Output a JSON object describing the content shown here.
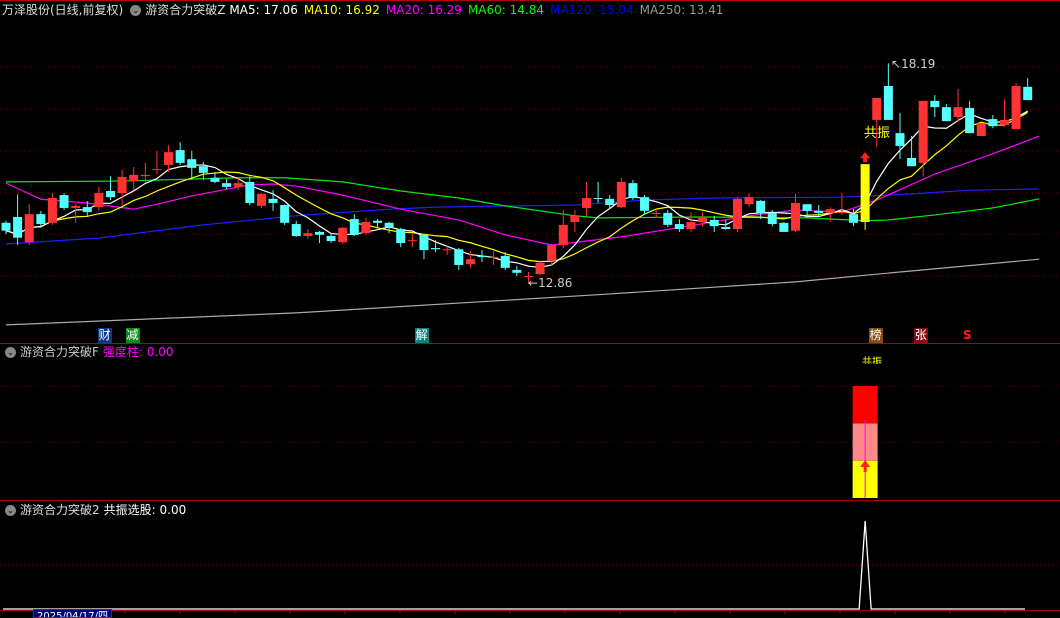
{
  "header": {
    "stock": "万泽股份(日线,前复权)",
    "indicator": "游资合力突破Z",
    "ma": [
      {
        "label": "MA5: 17.06",
        "color": "#ffffff"
      },
      {
        "label": "MA10: 16.92",
        "color": "#ffff00"
      },
      {
        "label": "MA20: 16.29",
        "color": "#ff00ff"
      },
      {
        "label": "MA60: 14.84",
        "color": "#00ff00"
      },
      {
        "label": "MA120: 15.04",
        "color": "#0000ff"
      },
      {
        "label": "MA250: 13.41",
        "color": "#999999"
      }
    ]
  },
  "annotations": {
    "high": "18.19",
    "low": "12.86",
    "resonance": "共振"
  },
  "event_tags": [
    {
      "text": "财",
      "bg": "#0a3a8a",
      "index": 8.5
    },
    {
      "text": "减",
      "bg": "#0a8a1a",
      "index": 10.9
    },
    {
      "text": "解",
      "bg": "#0a8080",
      "index": 35.8
    },
    {
      "text": "榜",
      "bg": "#8a4a10",
      "index": 74.9
    },
    {
      "text": "张",
      "bg": "#8a0a10",
      "index": 78.8
    }
  ],
  "sell_tag": {
    "text": "S",
    "index": 82.8
  },
  "panel2": {
    "title": "游资合力突破F",
    "value_label": "强度柱: 0.00",
    "resonance": "共振"
  },
  "panel3": {
    "title": "游资合力突破2",
    "value_label": "共振选股: 0.00"
  },
  "axis": {
    "date": "2025/04/17/四"
  },
  "colors": {
    "up": "#ff3333",
    "down": "#54ffff",
    "signal": "#ffff00",
    "grid": "#8b0000",
    "border": "#b00000"
  },
  "candles": [
    [
      14.33,
      14.14,
      14.38,
      14.06
    ],
    [
      14.47,
      13.97,
      15.02,
      13.79
    ],
    [
      13.86,
      14.54,
      14.78,
      13.79
    ],
    [
      14.54,
      14.3,
      14.62,
      14.21
    ],
    [
      14.33,
      14.93,
      15.05,
      14.28
    ],
    [
      15.0,
      14.69,
      15.05,
      14.64
    ],
    [
      14.69,
      14.74,
      14.78,
      14.33
    ],
    [
      14.71,
      14.59,
      14.86,
      14.47
    ],
    [
      14.71,
      15.05,
      15.2,
      14.62
    ],
    [
      15.1,
      14.95,
      15.46,
      14.88
    ],
    [
      15.05,
      15.44,
      15.61,
      14.76
    ],
    [
      15.34,
      15.49,
      15.68,
      15.12
    ],
    [
      15.46,
      15.49,
      15.78,
      15.29
    ],
    [
      15.61,
      15.63,
      16.07,
      15.51
    ],
    [
      15.73,
      16.04,
      16.21,
      15.56
    ],
    [
      16.09,
      15.78,
      16.28,
      15.73
    ],
    [
      15.87,
      15.66,
      16.07,
      15.37
    ],
    [
      15.7,
      15.54,
      15.8,
      15.37
    ],
    [
      15.42,
      15.32,
      15.56,
      15.29
    ],
    [
      15.29,
      15.2,
      15.39,
      15.15
    ],
    [
      15.2,
      15.29,
      15.42,
      15.12
    ],
    [
      15.32,
      14.81,
      15.46,
      14.76
    ],
    [
      14.74,
      15.03,
      15.05,
      14.69
    ],
    [
      14.91,
      14.81,
      15.12,
      14.62
    ],
    [
      14.76,
      14.33,
      14.78,
      14.28
    ],
    [
      14.3,
      14.01,
      14.38,
      13.99
    ],
    [
      14.01,
      14.08,
      14.18,
      13.94
    ],
    [
      14.11,
      14.04,
      14.13,
      13.84
    ],
    [
      14.01,
      13.89,
      14.08,
      13.84
    ],
    [
      13.86,
      14.21,
      14.23,
      13.82
    ],
    [
      14.42,
      14.04,
      14.54,
      14.01
    ],
    [
      14.08,
      14.35,
      14.45,
      14.04
    ],
    [
      14.38,
      14.33,
      14.42,
      14.21
    ],
    [
      14.33,
      14.23,
      14.35,
      14.08
    ],
    [
      14.18,
      13.84,
      14.21,
      13.74
    ],
    [
      13.89,
      13.91,
      14.06,
      13.74
    ],
    [
      14.04,
      13.67,
      14.04,
      13.45
    ],
    [
      13.72,
      13.69,
      13.91,
      13.62
    ],
    [
      13.67,
      13.69,
      13.79,
      13.55
    ],
    [
      13.69,
      13.31,
      13.72,
      13.19
    ],
    [
      13.33,
      13.45,
      13.65,
      13.24
    ],
    [
      13.53,
      13.5,
      13.67,
      13.38
    ],
    [
      13.48,
      13.5,
      13.65,
      13.31
    ],
    [
      13.53,
      13.24,
      13.62,
      13.19
    ],
    [
      13.19,
      13.12,
      13.29,
      13.04
    ],
    [
      13.02,
      13.04,
      13.14,
      12.86
    ],
    [
      13.09,
      13.36,
      13.41,
      13.07
    ],
    [
      13.41,
      13.79,
      13.82,
      13.31
    ],
    [
      13.79,
      14.28,
      14.64,
      13.72
    ],
    [
      14.35,
      14.5,
      14.64,
      14.11
    ],
    [
      14.69,
      14.93,
      15.32,
      14.5
    ],
    [
      14.93,
      14.91,
      15.32,
      14.81
    ],
    [
      14.91,
      14.76,
      15.0,
      14.69
    ],
    [
      14.71,
      15.32,
      15.42,
      14.69
    ],
    [
      15.29,
      14.93,
      15.37,
      14.88
    ],
    [
      14.95,
      14.62,
      15.0,
      14.52
    ],
    [
      14.57,
      14.57,
      14.66,
      14.45
    ],
    [
      14.57,
      14.28,
      14.64,
      14.23
    ],
    [
      14.3,
      14.18,
      14.42,
      14.11
    ],
    [
      14.18,
      14.35,
      14.59,
      14.11
    ],
    [
      14.35,
      14.45,
      14.59,
      14.23
    ],
    [
      14.4,
      14.25,
      14.5,
      14.11
    ],
    [
      14.23,
      14.18,
      14.4,
      14.16
    ],
    [
      14.18,
      14.91,
      14.95,
      14.11
    ],
    [
      14.78,
      14.95,
      15.05,
      14.71
    ],
    [
      14.86,
      14.57,
      14.88,
      14.42
    ],
    [
      14.57,
      14.3,
      14.64,
      14.25
    ],
    [
      14.33,
      14.11,
      14.35,
      14.11
    ],
    [
      14.14,
      14.81,
      15.03,
      14.11
    ],
    [
      14.78,
      14.62,
      14.78,
      14.45
    ],
    [
      14.62,
      14.57,
      14.76,
      14.49
    ],
    [
      14.57,
      14.66,
      14.71,
      14.35
    ],
    [
      14.59,
      14.59,
      15.05,
      14.52
    ],
    [
      14.54,
      14.33,
      14.66,
      14.25
    ],
    [
      14.35,
      15.75,
      15.75,
      14.16
    ],
    [
      16.82,
      17.35,
      17.35,
      16.16
    ],
    [
      17.64,
      16.82,
      18.19,
      16.82
    ],
    [
      16.5,
      16.19,
      16.99,
      15.87
    ],
    [
      15.9,
      15.7,
      16.43,
      15.7
    ],
    [
      15.78,
      17.28,
      17.28,
      15.46
    ],
    [
      17.28,
      17.13,
      17.42,
      16.89
    ],
    [
      17.13,
      16.79,
      17.2,
      16.79
    ],
    [
      16.89,
      17.13,
      17.57,
      16.77
    ],
    [
      17.11,
      16.5,
      17.28,
      16.5
    ],
    [
      16.43,
      16.74,
      16.74,
      16.43
    ],
    [
      16.84,
      16.67,
      16.94,
      16.62
    ],
    [
      16.7,
      16.82,
      17.32,
      16.65
    ],
    [
      16.6,
      17.64,
      17.71,
      16.6
    ],
    [
      17.62,
      17.3,
      17.83,
      17.3
    ]
  ],
  "signal_index": 74,
  "ma_lines": {
    "ma20": [
      [
        0,
        15.29
      ],
      [
        3,
        14.9
      ],
      [
        7,
        14.81
      ],
      [
        11,
        14.66
      ],
      [
        13,
        14.78
      ],
      [
        16,
        14.98
      ],
      [
        21,
        15.25
      ],
      [
        23,
        15.27
      ],
      [
        25,
        15.22
      ],
      [
        29,
        15.0
      ],
      [
        34,
        14.66
      ],
      [
        39,
        14.4
      ],
      [
        43,
        14.04
      ],
      [
        47,
        13.79
      ],
      [
        53,
        13.99
      ],
      [
        59,
        14.26
      ],
      [
        64,
        14.5
      ],
      [
        68,
        14.64
      ],
      [
        72,
        14.59
      ],
      [
        75,
        14.88
      ],
      [
        80,
        15.51
      ],
      [
        85,
        16.0
      ],
      [
        89,
        16.43
      ]
    ],
    "ma60": [
      [
        0,
        15.32
      ],
      [
        10,
        15.34
      ],
      [
        20,
        15.42
      ],
      [
        24,
        15.42
      ],
      [
        29,
        15.32
      ],
      [
        34,
        15.1
      ],
      [
        39,
        14.93
      ],
      [
        43,
        14.74
      ],
      [
        49,
        14.5
      ],
      [
        51,
        14.45
      ],
      [
        60,
        14.47
      ],
      [
        69,
        14.45
      ],
      [
        74,
        14.38
      ],
      [
        76,
        14.4
      ],
      [
        80,
        14.52
      ],
      [
        85,
        14.69
      ],
      [
        89,
        14.91
      ]
    ],
    "ma120": [
      [
        0,
        13.82
      ],
      [
        8,
        13.96
      ],
      [
        17,
        14.28
      ],
      [
        25,
        14.5
      ],
      [
        33,
        14.66
      ],
      [
        37,
        14.71
      ],
      [
        49,
        14.76
      ],
      [
        55,
        14.88
      ],
      [
        61,
        14.93
      ],
      [
        72,
        14.95
      ],
      [
        78,
        15.03
      ],
      [
        83,
        15.12
      ],
      [
        89,
        15.15
      ]
    ],
    "ma250": [
      [
        0,
        11.86
      ],
      [
        25,
        12.15
      ],
      [
        51,
        12.59
      ],
      [
        68,
        12.9
      ],
      [
        77,
        13.14
      ],
      [
        89,
        13.45
      ]
    ]
  },
  "strength_bar": {
    "segments": [
      {
        "color": "#ffff00",
        "level": 1
      },
      {
        "color": "#ff8888",
        "level": 2
      },
      {
        "color": "#ff0000",
        "level": 3
      }
    ],
    "max": 3
  },
  "resonance_series": {
    "peak_index": 74,
    "peak_value": 1
  }
}
